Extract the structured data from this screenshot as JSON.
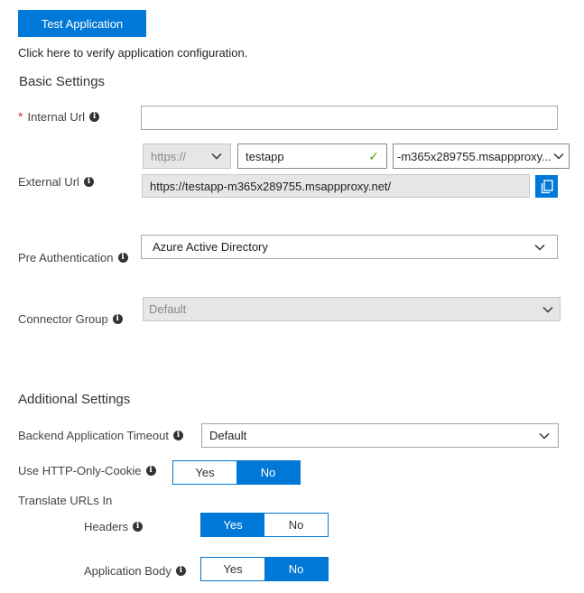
{
  "test_button": {
    "label": "Test Application"
  },
  "hint_text": "Click here to verify application configuration.",
  "basic_settings": {
    "title": "Basic Settings",
    "internal_url": {
      "label": "Internal Url",
      "value": ""
    },
    "external_url": {
      "label": "External Url",
      "scheme": "https://",
      "subdomain": "testapp",
      "domain": "-m365x289755.msappproxy...",
      "full_url": "https://testapp-m365x289755.msappproxy.net/"
    },
    "pre_authentication": {
      "label": "Pre Authentication",
      "value": "Azure Active Directory"
    },
    "connector_group": {
      "label": "Connector Group",
      "value": "Default"
    }
  },
  "additional_settings": {
    "title": "Additional Settings",
    "backend_timeout": {
      "label": "Backend Application Timeout",
      "value": "Default"
    },
    "http_only_cookie": {
      "label": "Use HTTP-Only-Cookie",
      "yes": "Yes",
      "no": "No",
      "selected": "No"
    },
    "translate_urls": {
      "label": "Translate URLs In",
      "headers": {
        "label": "Headers",
        "yes": "Yes",
        "no": "No",
        "selected": "Yes"
      },
      "application_body": {
        "label": "Application Body",
        "yes": "Yes",
        "no": "No",
        "selected": "No"
      }
    }
  },
  "colors": {
    "accent": "#0078d7",
    "required": "#d13438",
    "valid": "#57a300"
  }
}
